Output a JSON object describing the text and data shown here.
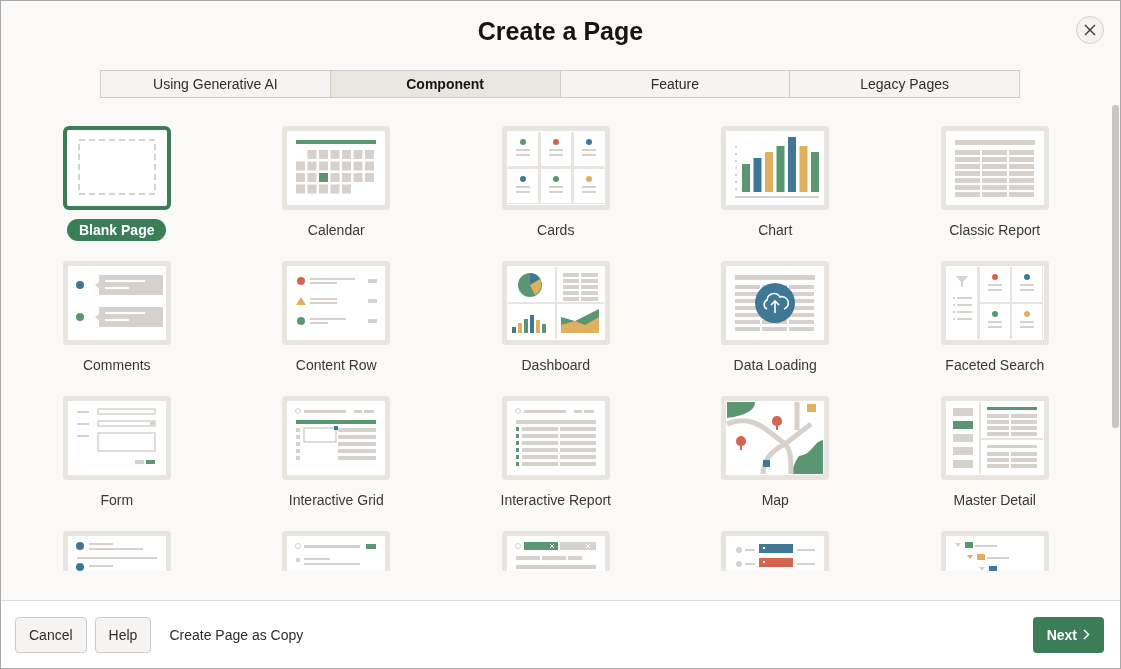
{
  "dialog": {
    "title": "Create a Page"
  },
  "tabs": [
    {
      "label": "Using Generative AI",
      "selected": false
    },
    {
      "label": "Component",
      "selected": true
    },
    {
      "label": "Feature",
      "selected": false
    },
    {
      "label": "Legacy Pages",
      "selected": false
    }
  ],
  "items": [
    {
      "label": "Blank Page",
      "kind": "blank",
      "selected": true
    },
    {
      "label": "Calendar",
      "kind": "calendar",
      "selected": false
    },
    {
      "label": "Cards",
      "kind": "cards",
      "selected": false
    },
    {
      "label": "Chart",
      "kind": "chart",
      "selected": false
    },
    {
      "label": "Classic Report",
      "kind": "classic-report",
      "selected": false
    },
    {
      "label": "Comments",
      "kind": "comments",
      "selected": false
    },
    {
      "label": "Content Row",
      "kind": "content-row",
      "selected": false
    },
    {
      "label": "Dashboard",
      "kind": "dashboard",
      "selected": false
    },
    {
      "label": "Data Loading",
      "kind": "data-loading",
      "selected": false
    },
    {
      "label": "Faceted Search",
      "kind": "faceted-search",
      "selected": false
    },
    {
      "label": "Form",
      "kind": "form",
      "selected": false
    },
    {
      "label": "Interactive Grid",
      "kind": "interactive-grid",
      "selected": false
    },
    {
      "label": "Interactive Report",
      "kind": "interactive-report",
      "selected": false
    },
    {
      "label": "Map",
      "kind": "map",
      "selected": false
    },
    {
      "label": "Master Detail",
      "kind": "master-detail",
      "selected": false
    },
    {
      "kind": "list-view",
      "selected": false
    },
    {
      "kind": "search-page",
      "selected": false
    },
    {
      "kind": "smart-filters",
      "selected": false
    },
    {
      "kind": "task-list",
      "selected": false
    },
    {
      "kind": "tree",
      "selected": false
    }
  ],
  "footer": {
    "buttons": [
      "Cancel",
      "Help"
    ],
    "link": "Create Page as Copy",
    "next": "Next"
  }
}
